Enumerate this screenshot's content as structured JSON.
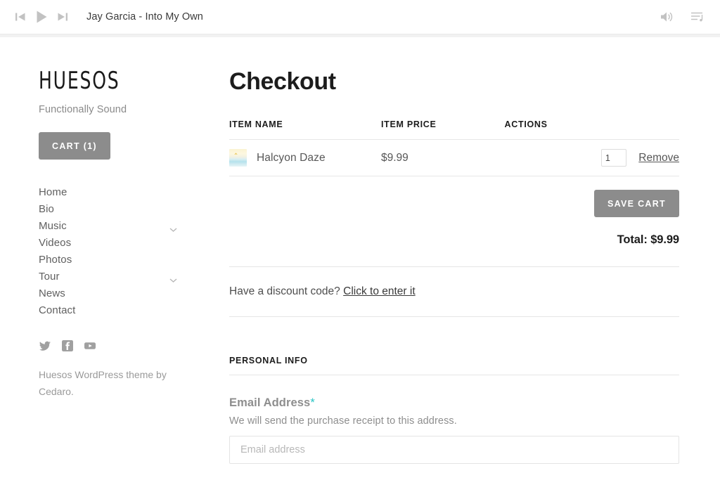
{
  "player": {
    "prev_icon": "skip-previous-icon",
    "play_icon": "play-icon",
    "next_icon": "skip-next-icon",
    "track_title": "Jay Garcia - Into My Own",
    "volume_icon": "volume-icon",
    "playlist_icon": "playlist-icon"
  },
  "sidebar": {
    "logo": "HUESOS",
    "tagline": "Functionally Sound",
    "cart_button": "CART (1)",
    "nav": [
      {
        "label": "Home",
        "has_chevron": false
      },
      {
        "label": "Bio",
        "has_chevron": false
      },
      {
        "label": "Music",
        "has_chevron": true
      },
      {
        "label": "Videos",
        "has_chevron": false
      },
      {
        "label": "Photos",
        "has_chevron": false
      },
      {
        "label": "Tour",
        "has_chevron": true
      },
      {
        "label": "News",
        "has_chevron": false
      },
      {
        "label": "Contact",
        "has_chevron": false
      }
    ],
    "social": [
      {
        "name": "twitter-icon"
      },
      {
        "name": "facebook-icon"
      },
      {
        "name": "youtube-icon"
      }
    ],
    "colophon": "Huesos WordPress theme by Cedaro."
  },
  "main": {
    "title": "Checkout",
    "table": {
      "headers": [
        "ITEM NAME",
        "ITEM PRICE",
        "ACTIONS"
      ],
      "rows": [
        {
          "item_name": "Halcyon Daze",
          "item_price": "$9.99",
          "quantity": "1",
          "remove_label": "Remove"
        }
      ]
    },
    "save_cart_label": "SAVE CART",
    "total": "Total: $9.99",
    "discount_prompt": "Have a discount code?",
    "discount_link": "Click to enter it",
    "personal_info_heading": "PERSONAL INFO",
    "email_label": "Email Address",
    "required_marker": "*",
    "email_description": "We will send the purchase receipt to this address.",
    "email_placeholder": "Email address"
  },
  "colors": {
    "button_gray": "#8c8c8c",
    "required_teal": "#2bc4c4",
    "border_gray": "#e6e6e6"
  }
}
